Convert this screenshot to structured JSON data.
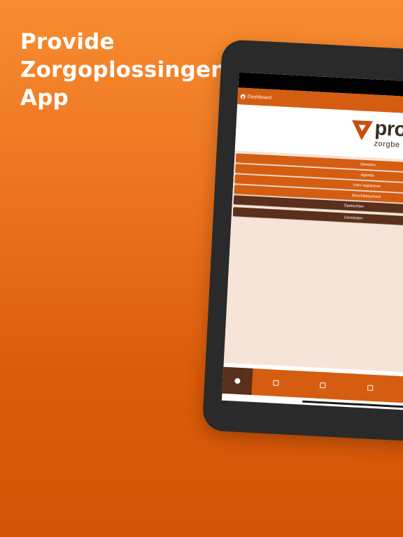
{
  "headline": {
    "line1": "Provide",
    "line2": "Zorgoplossingen",
    "line3": "App"
  },
  "app": {
    "navbar_title": "Dashboard",
    "logo": {
      "text": "pro",
      "subtext": "zorgbe"
    },
    "menu": {
      "items": [
        "Diensten",
        "Agenda",
        "Uren registreren",
        "Beschikbaarheid"
      ],
      "dark_row1": [
        "Opdrachten",
        ""
      ],
      "dark_row2": [
        "Urenstaten",
        ""
      ]
    },
    "tabbar": {
      "tabs": [
        {
          "icon": "dashboard-icon",
          "active": true
        },
        {
          "icon": "list-icon",
          "active": false
        },
        {
          "icon": "id-card-icon",
          "active": false
        },
        {
          "icon": "clock-icon",
          "active": false
        },
        {
          "icon": "calendar-icon",
          "active": false
        },
        {
          "icon": "car-icon",
          "active": false
        }
      ]
    }
  },
  "colors": {
    "background_top": "#f88c30",
    "background_bottom": "#d35406",
    "accent": "#d55d12",
    "dark_accent": "#5a2f1c",
    "menu_background": "#f7e4d8"
  }
}
